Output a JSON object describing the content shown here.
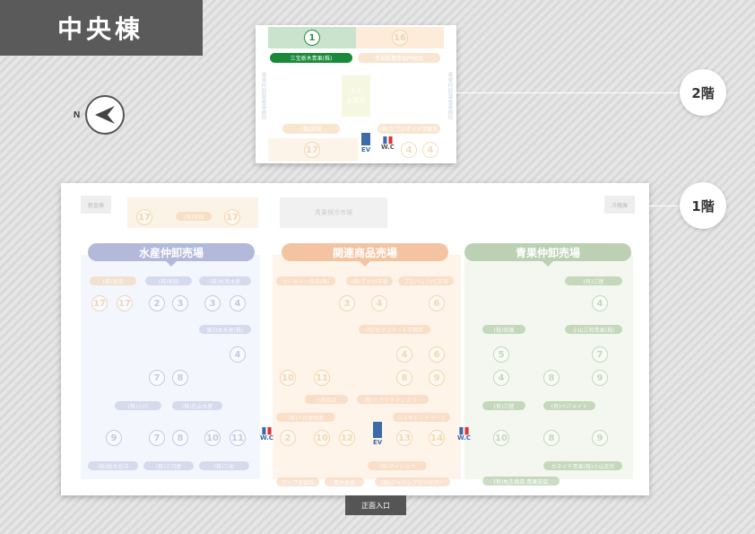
{
  "title": "中央棟",
  "compass": {
    "label": "N"
  },
  "floors": {
    "floor2": {
      "label": "2階"
    },
    "floor1": {
      "label": "1階"
    }
  },
  "entrance": {
    "label": "正面入口"
  },
  "floor2_map": {
    "top_left_number": "1",
    "top_right_number": "16",
    "shop_green": "三宝栃木青果(株)",
    "shop_orange_top": "茨城県農業協同組合",
    "center_label": "中央\n会議室",
    "left_side": "青果仲卸業者事務所",
    "right_side": "青果仲卸業者事務所",
    "bottom_shop": "(株)宮田",
    "bottom_right_shop": "(株)セブンネット宇都宮",
    "bottom_number": "17",
    "ev_label": "EV",
    "wc_label": "W.C",
    "num_a": "4",
    "num_b": "4"
  },
  "floor1_map": {
    "sections": {
      "seafood": "水産仲卸売場",
      "related": "関連商品売場",
      "produce": "青果仲卸売場"
    },
    "top_strip": {
      "left_label": "新倉庫",
      "n17a": "17",
      "shop": "(株)宮田",
      "n17b": "17",
      "center": "青果保冷市場",
      "right_label": "冷蔵庫"
    },
    "ev_label": "EV",
    "wc_label": "W.C",
    "seafood_labels": [
      "(株)宮田",
      "(株)和田",
      "(株)丸宮水産",
      "東日本水産(株)",
      "(株)小川",
      "(株)荘山水産",
      "(株)栃木北洋",
      "(株)三河屋",
      "(株)三松"
    ],
    "seafood_numbers": [
      "17",
      "17",
      "2",
      "3",
      "3",
      "4",
      "4",
      "7",
      "8",
      "9",
      "7",
      "8",
      "10",
      "11"
    ],
    "related_labels": [
      "ゴールデン商事(株)",
      "(株)すがの市場",
      "プロパックPC市場"
    ],
    "related_mid_labels": [
      "(株)セブンネット宇都宮",
      "小野商店",
      "(株)ヒカリネマンスリー",
      "(株)八百屋物産",
      "ハイキャッチワーク",
      "(株)ダイショウ",
      "アップス会社",
      "青木食品",
      "(株)ジャパンフリーツアー"
    ],
    "related_numbers": [
      "3",
      "4",
      "6",
      "4",
      "6",
      "10",
      "11",
      "8",
      "9",
      "2",
      "10",
      "12",
      "13",
      "14"
    ],
    "produce_labels": [
      "(有)三徳",
      "(株)宮園",
      "小山三和青果(株)",
      "(有)三徳",
      "(有)ベジメイト",
      "カネイチ青果(株)小山支社",
      "(有)丸久商店 青果支店"
    ],
    "produce_numbers": [
      "4",
      "5",
      "7",
      "4",
      "8",
      "9",
      "10",
      "8",
      "9"
    ]
  }
}
